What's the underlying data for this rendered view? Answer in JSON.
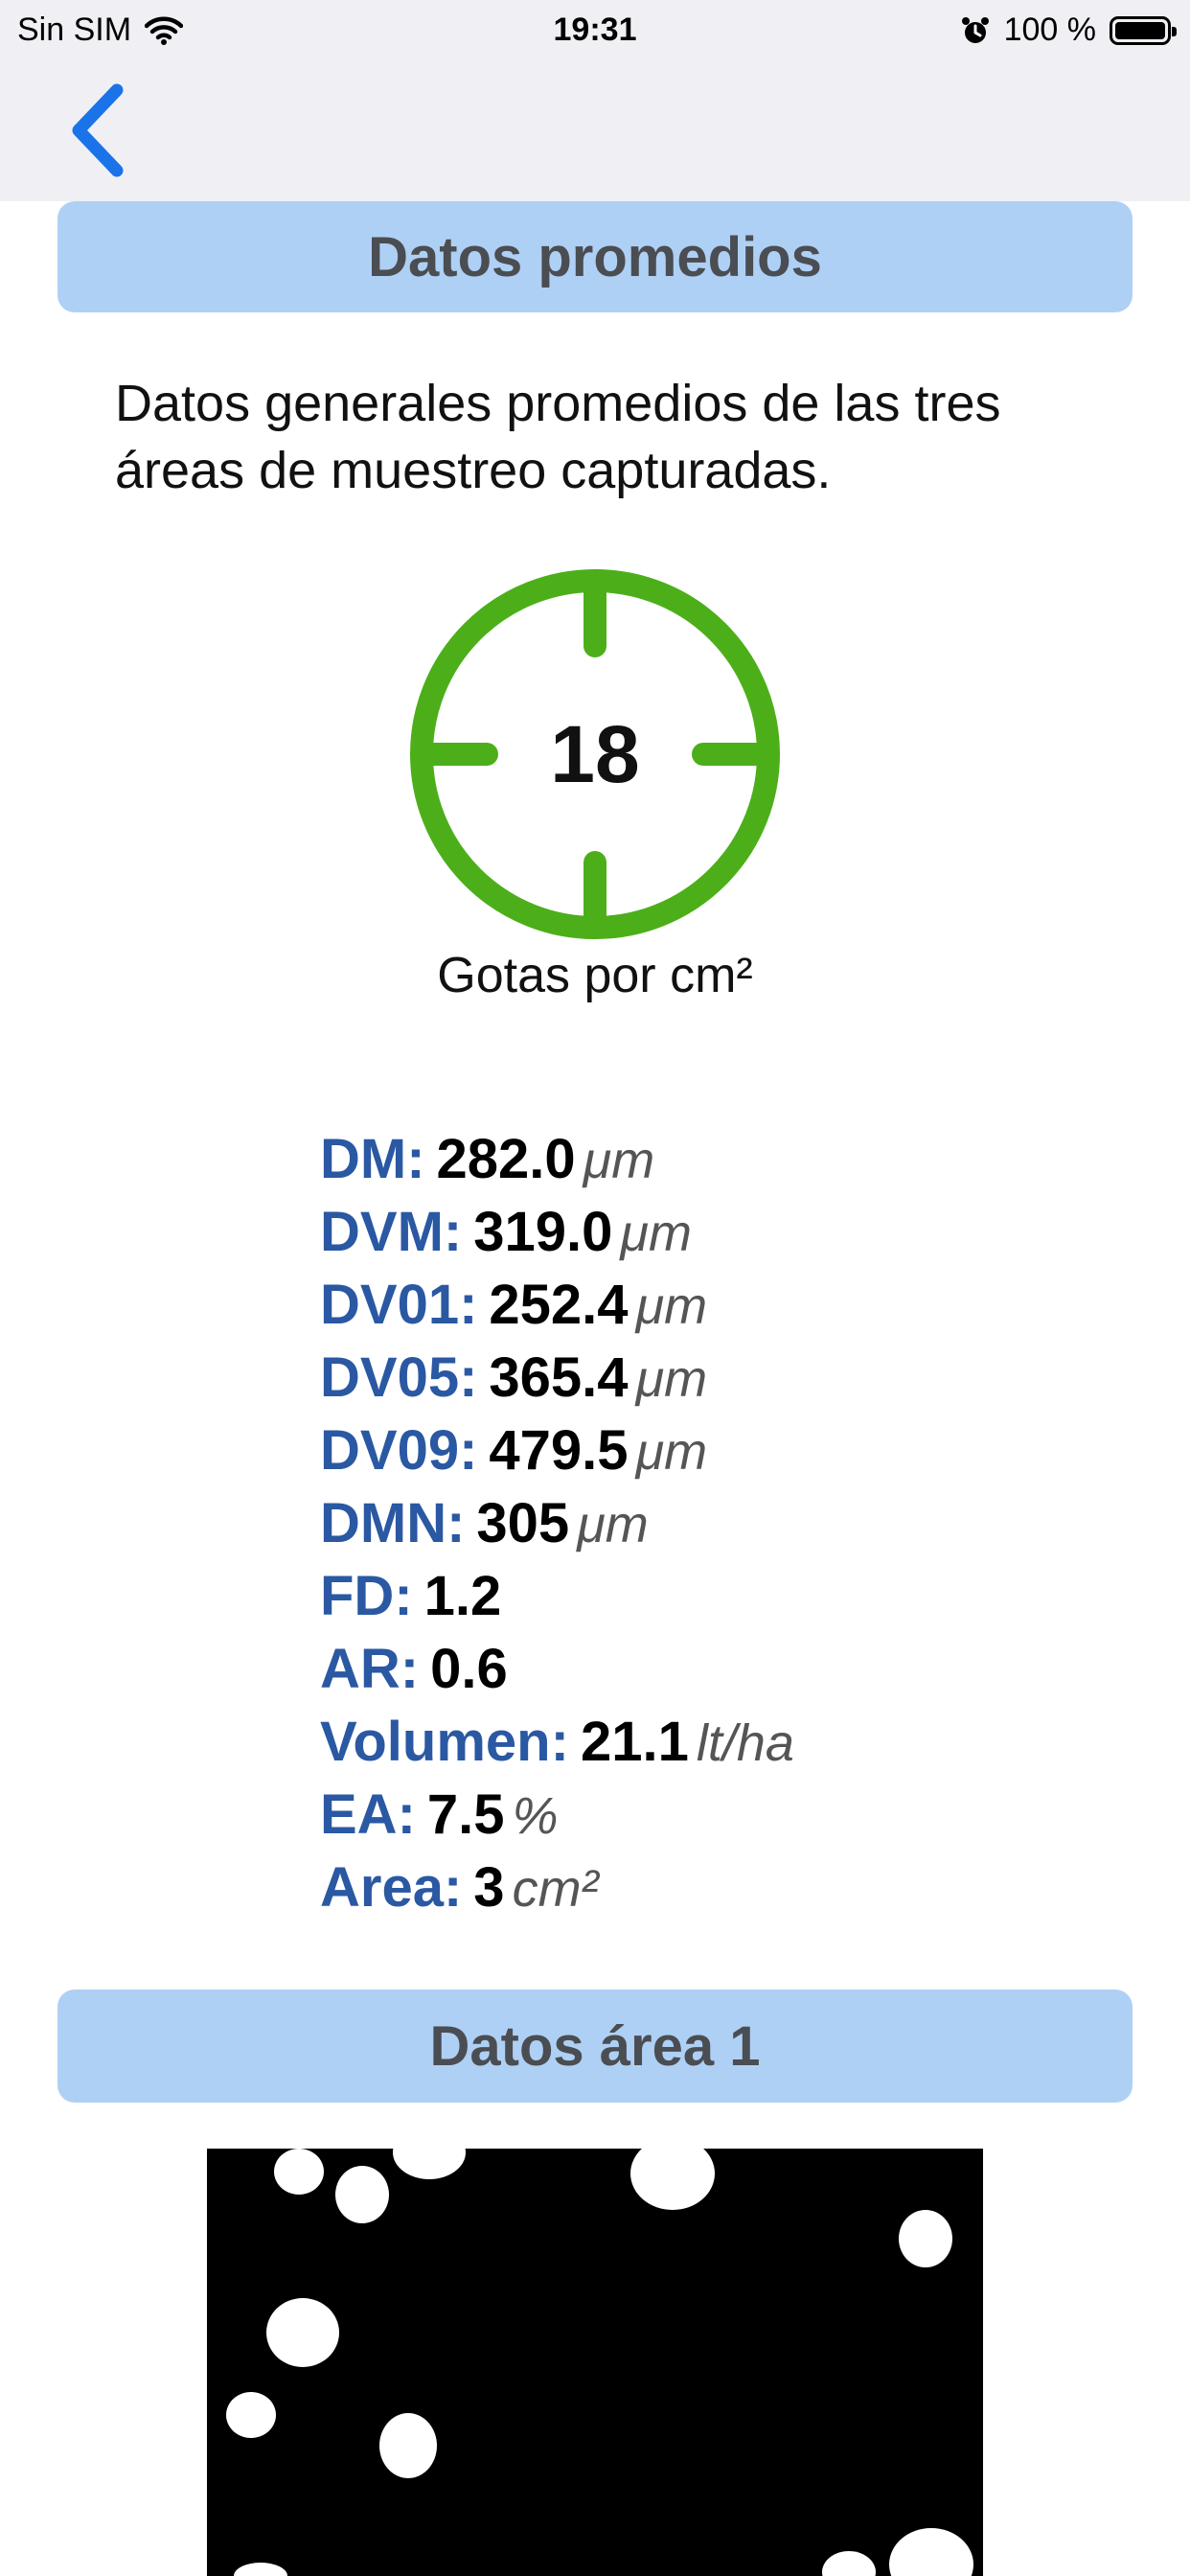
{
  "status_bar": {
    "carrier": "Sin SIM",
    "time": "19:31",
    "battery_label": "100 %",
    "battery_level": 1.0,
    "icons": [
      "wifi-icon",
      "alarm-icon",
      "battery-icon"
    ]
  },
  "nav": {
    "back_icon": "chevron-left-icon",
    "accent": "#1a73e8"
  },
  "averages": {
    "title": "Datos promedios",
    "intro": "Datos generales promedios de las tres áreas de muestreo capturadas.",
    "drops_per_cm2": "18",
    "drops_label": "Gotas por cm²",
    "target_color": "#4caf1a",
    "stats": [
      {
        "key": "DM:",
        "value": "282.0",
        "unit": "μm"
      },
      {
        "key": "DVM:",
        "value": "319.0",
        "unit": "μm"
      },
      {
        "key": "DV01:",
        "value": "252.4",
        "unit": "μm"
      },
      {
        "key": "DV05:",
        "value": "365.4",
        "unit": "μm"
      },
      {
        "key": "DV09:",
        "value": "479.5",
        "unit": "μm"
      },
      {
        "key": "DMN:",
        "value": "305",
        "unit": "μm"
      },
      {
        "key": "FD:",
        "value": "1.2",
        "unit": ""
      },
      {
        "key": "AR:",
        "value": "0.6",
        "unit": ""
      },
      {
        "key": "Volumen:",
        "value": "21.1",
        "unit": "lt/ha"
      },
      {
        "key": "EA:",
        "value": "7.5",
        "unit": "%"
      },
      {
        "key": "Area:",
        "value": "3",
        "unit": "cm²"
      }
    ]
  },
  "area1": {
    "title": "Datos área 1",
    "image": "droplet-sample-image"
  },
  "colors": {
    "header_bg": "#afd0f5",
    "header_text": "#4a4d52",
    "stat_key": "#2a58a3",
    "topbar_bg": "#efeff4"
  }
}
